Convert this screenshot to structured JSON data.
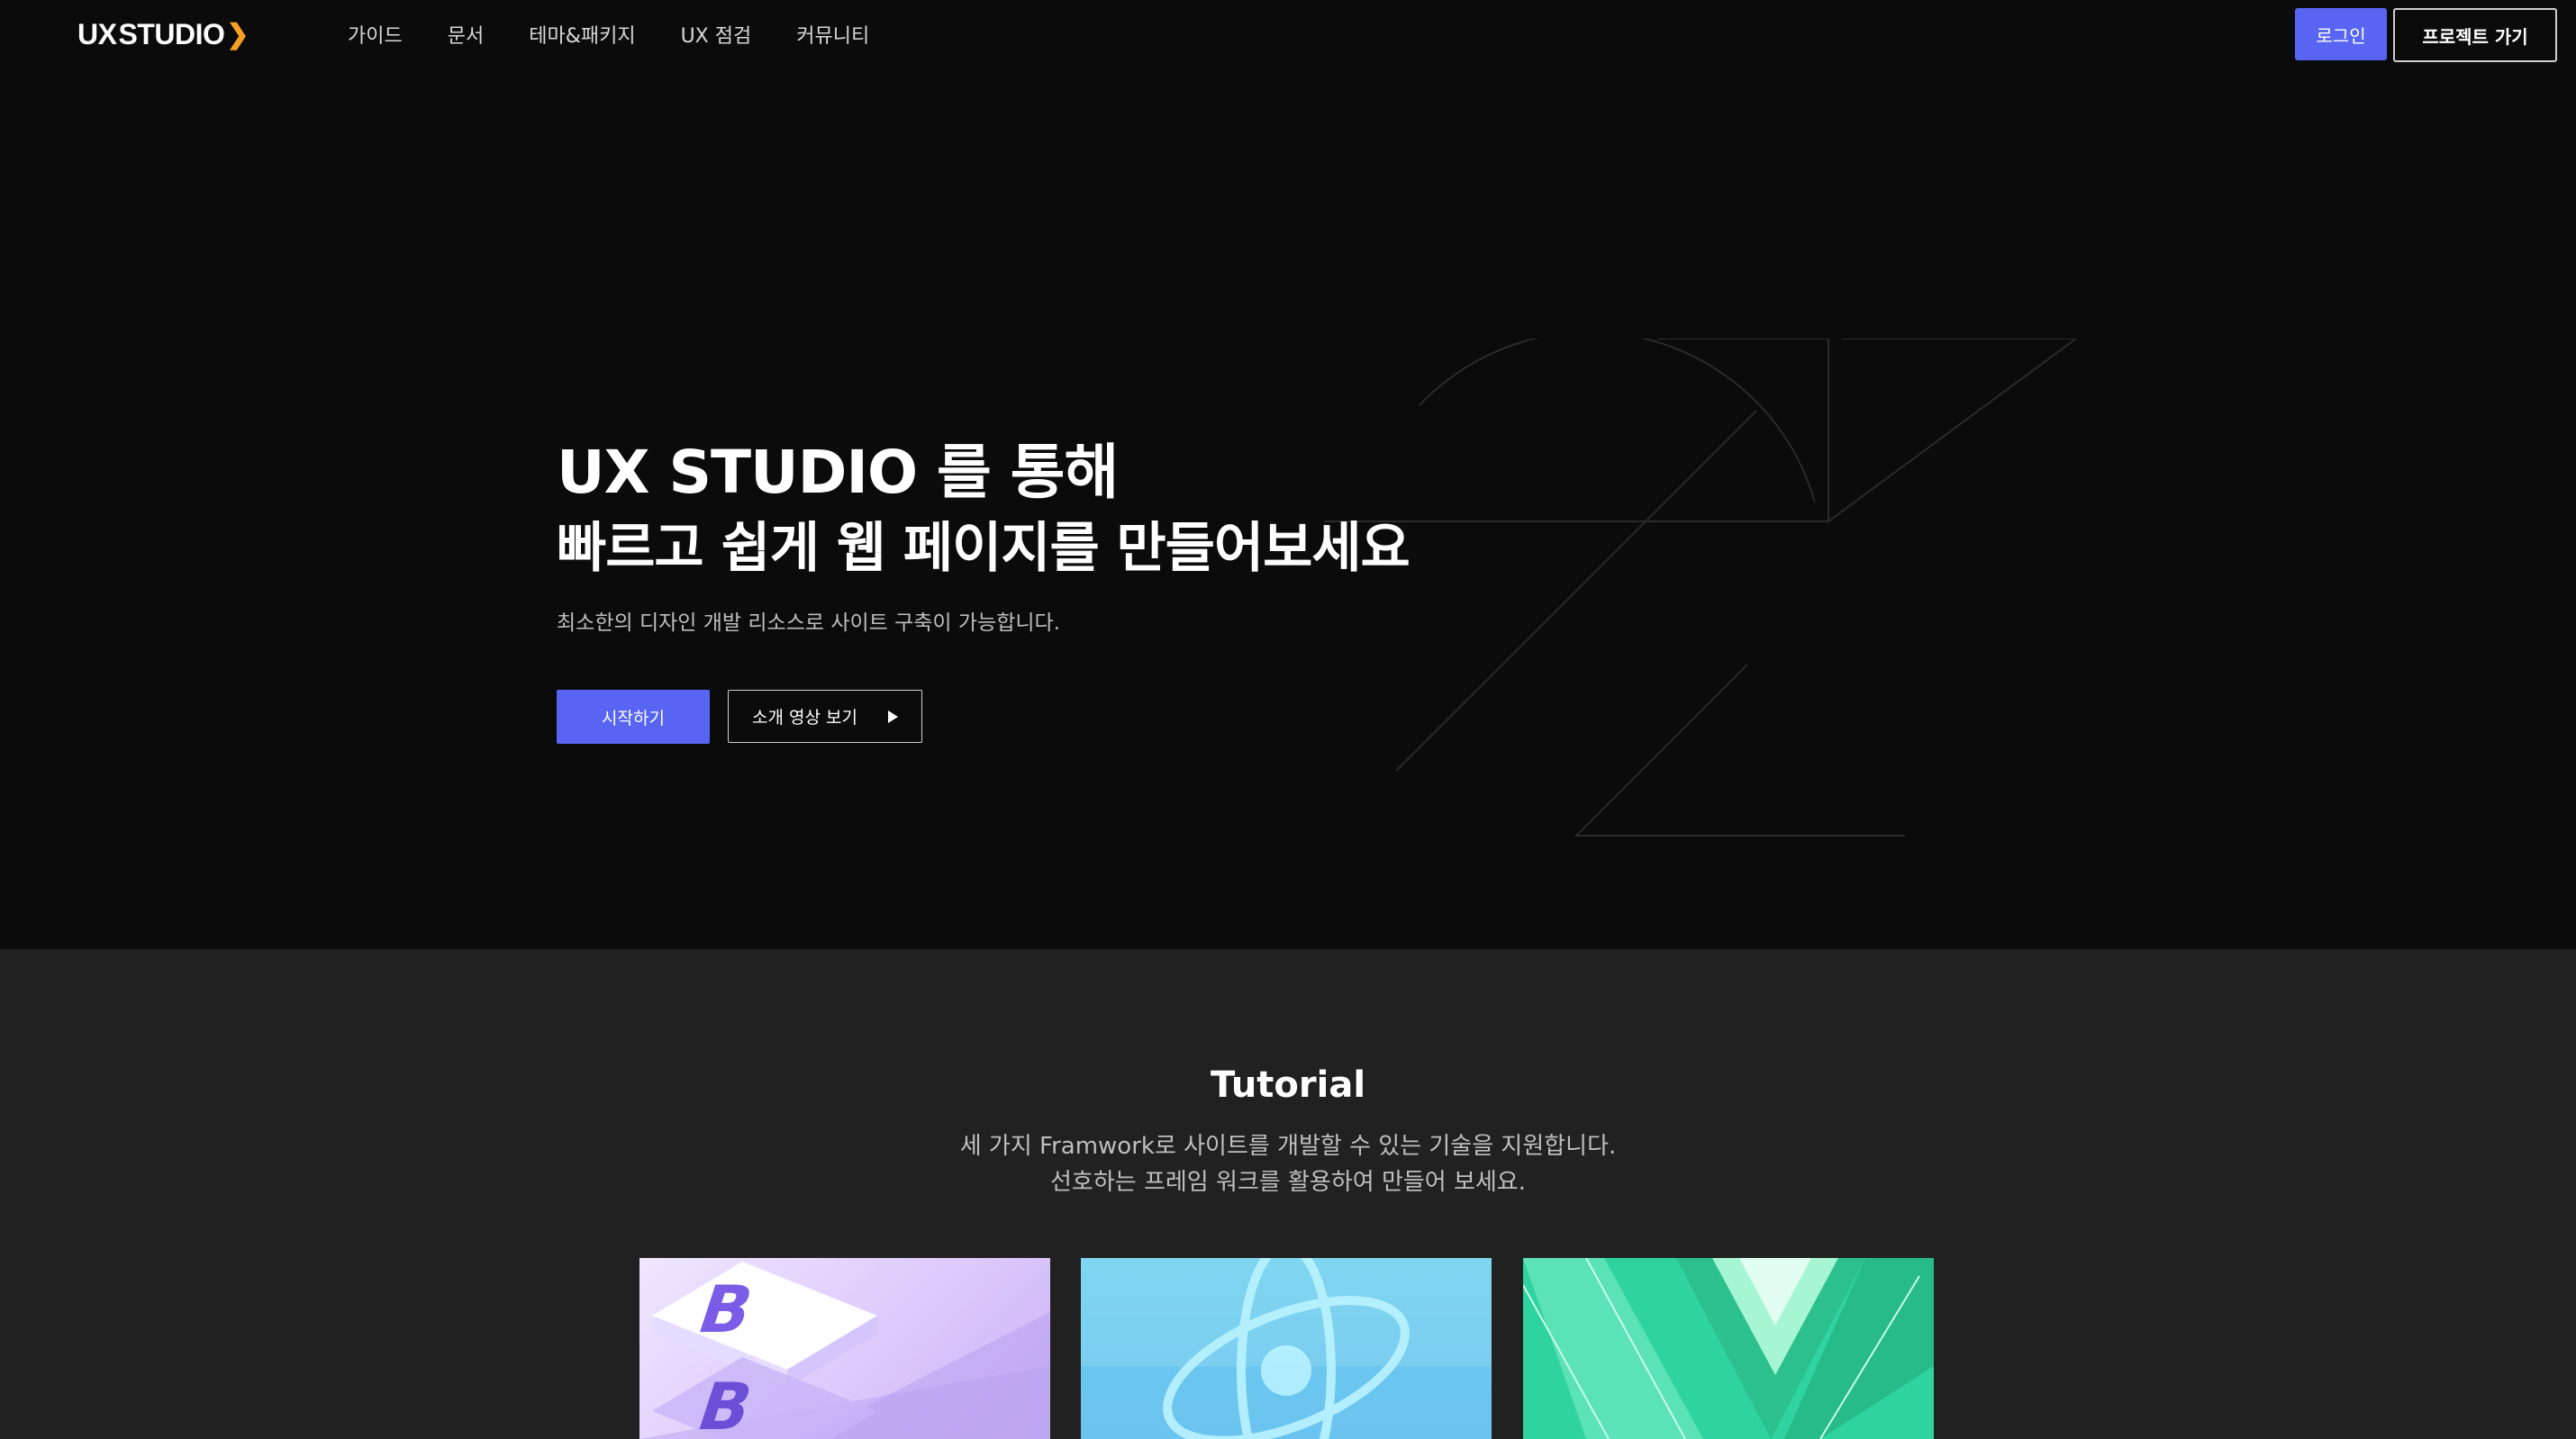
{
  "header": {
    "logo_prefix": "UX",
    "logo_main": "STUDIO",
    "nav": [
      "가이드",
      "문서",
      "테마&패키지",
      "UX 점검",
      "커뮤니티"
    ],
    "login_label": "로그인",
    "project_label": "프로젝트 가기"
  },
  "hero": {
    "title_line1": "UX STUDIO 를 통해",
    "title_line2": "빠르고 쉽게 웹 페이지를 만들어보세요",
    "subtitle": "최소한의 디자인 개발 리소스로 사이트 구축이 가능합니다.",
    "start_label": "시작하기",
    "video_label": "소개 영상 보기"
  },
  "tutorial": {
    "title": "Tutorial",
    "desc_line1": "세 가지 Framwork로 사이트를 개발할 수 있는 기술을 지원합니다.",
    "desc_line2": "선호하는 프레임 워크를 활용하여 만들어 보세요."
  },
  "colors": {
    "accent": "#5865f2",
    "logo_chevron": "#f5a020",
    "hero_bg": "#0b0b0c",
    "tutorial_bg": "#212121"
  },
  "icons": {
    "logo_chevron": "chevron-right-icon",
    "play": "play-icon",
    "cards": [
      "bootstrap-logo",
      "react-logo",
      "vue-logo"
    ]
  }
}
